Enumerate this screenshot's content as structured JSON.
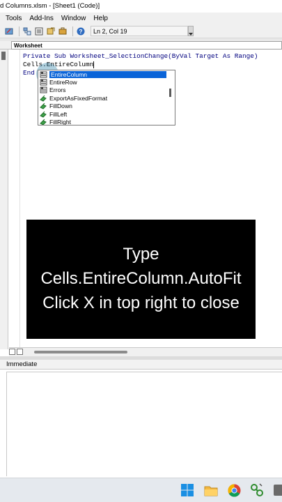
{
  "window": {
    "title": "d Columns.xlsm - [Sheet1 (Code)]"
  },
  "menu": {
    "items": [
      "Tools",
      "Add-Ins",
      "Window",
      "Help"
    ]
  },
  "toolbar": {
    "status": "Ln 2, Col 19"
  },
  "object_combo": {
    "value": "Worksheet"
  },
  "code": {
    "line1": "Private Sub Worksheet_SelectionChange(ByVal Target As Range)",
    "line2": "Cells.EntireColumn",
    "line3": "End"
  },
  "autocomplete": {
    "items": [
      {
        "label": "EntireColumn",
        "icon": "property-icon"
      },
      {
        "label": "EntireRow",
        "icon": "property-icon"
      },
      {
        "label": "Errors",
        "icon": "property-icon"
      },
      {
        "label": "ExportAsFixedFormat",
        "icon": "method-icon"
      },
      {
        "label": "FillDown",
        "icon": "method-icon"
      },
      {
        "label": "FillLeft",
        "icon": "method-icon"
      },
      {
        "label": "FillRight",
        "icon": "method-icon"
      }
    ],
    "selected": "EntireColumn"
  },
  "overlay": {
    "line1": "Type",
    "line2": "Cells.EntireColumn.AutoFit",
    "line3": "Click X in top right to close"
  },
  "immediate": {
    "title": "Immediate"
  },
  "colors": {
    "keyword": "#00007f",
    "selection": "#0a64d8",
    "overlay_bg": "#000000",
    "taskbar_bg": "#e5e9ee"
  },
  "taskbar": {
    "icons": [
      "windows-start-icon",
      "file-explorer-icon",
      "chrome-icon",
      "vba-app-icon",
      "app-icon"
    ]
  }
}
